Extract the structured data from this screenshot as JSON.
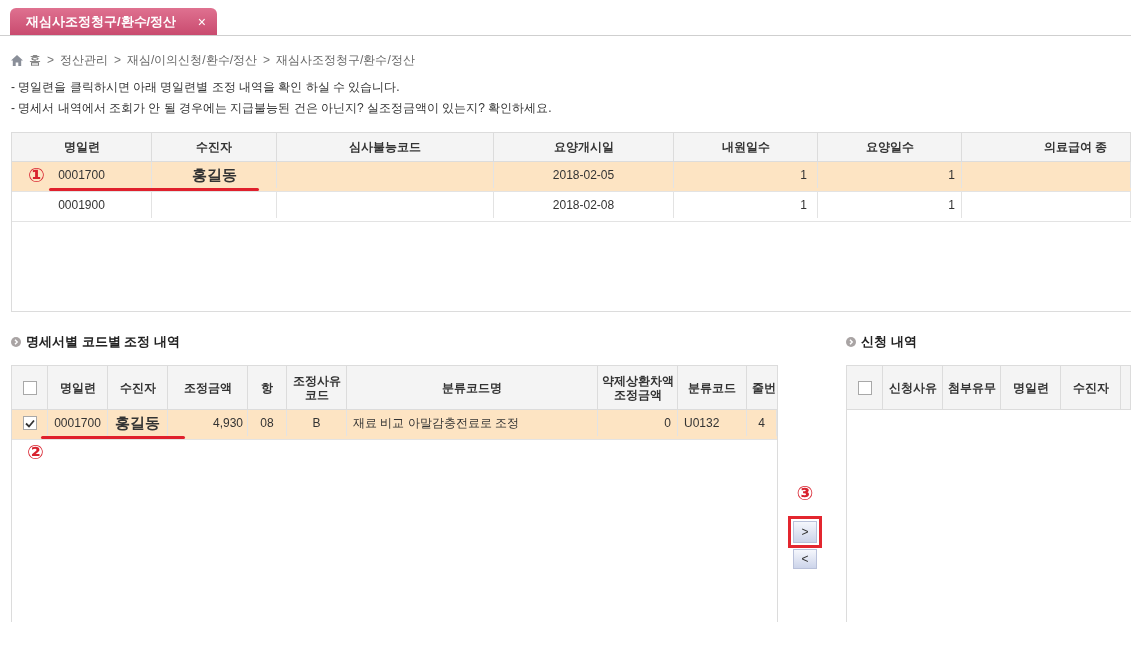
{
  "tabs": [
    {
      "label": "재심사조정청구/환수/정산",
      "close": "×",
      "selected": true
    }
  ],
  "breadcrumb": [
    {
      "label": "홈"
    },
    {
      "separator": ">",
      "label": "정산관리"
    },
    {
      "separator": ">",
      "label": "재심/이의신청/환수/정산"
    },
    {
      "separator": ">",
      "label": "재심사조정청구/환수/정산"
    }
  ],
  "notes": [
    "- 명일련을 클릭하시면 아래 명일련별 조정 내역을 확인 하실 수 있습니다.",
    "- 명세서 내역에서 조회가 안 될 경우에는 지급불능된 건은 아닌지? 실조정금액이 있는지? 확인하세요."
  ],
  "claims_table": {
    "columns": [
      "명일련",
      "수진자",
      "심사불능코드",
      "요양개시일",
      "내원일수",
      "요양일수",
      "의료급여 종"
    ],
    "rows": [
      {
        "selected": true,
        "callout": "①",
        "underlined": true,
        "serial": "0001700",
        "patient": "홍길동",
        "start_date": "2018-02-05",
        "visit_days": "1",
        "care_days": "1"
      },
      {
        "selected": false,
        "underlined": false,
        "serial": "0001900",
        "start_date": "2018-02-08",
        "visit_days": "1",
        "care_days": "1"
      }
    ]
  },
  "detail_table": {
    "title": "명세서별 코드별 조정 내역",
    "all_checked": false,
    "columns": [
      "명일련",
      "수진자",
      "조정금액",
      "항",
      "조정사유 코드",
      "분류코드명",
      "약제상환차액 조정금액",
      "분류코드",
      "줄번"
    ],
    "rows": [
      {
        "checked": true,
        "selected": true,
        "callout": "②",
        "underlined": true,
        "serial": "0001700",
        "patient": "홍길동",
        "amount": "4,930",
        "item": "08",
        "reason_code": "B",
        "category_name": "재료 비교 아말감충전료로 조정",
        "drug_amount": "0",
        "category_code": "U0132",
        "line_no": "4"
      }
    ]
  },
  "transfer_buttons": [
    {
      "label": ">",
      "highlighted": true,
      "callout": "③"
    },
    {
      "label": "<",
      "highlighted": false
    }
  ],
  "application_table": {
    "title": "신청 내역",
    "all_checked": false,
    "columns": [
      "신청사유",
      "첨부유무",
      "명일련",
      "수진자"
    ]
  }
}
